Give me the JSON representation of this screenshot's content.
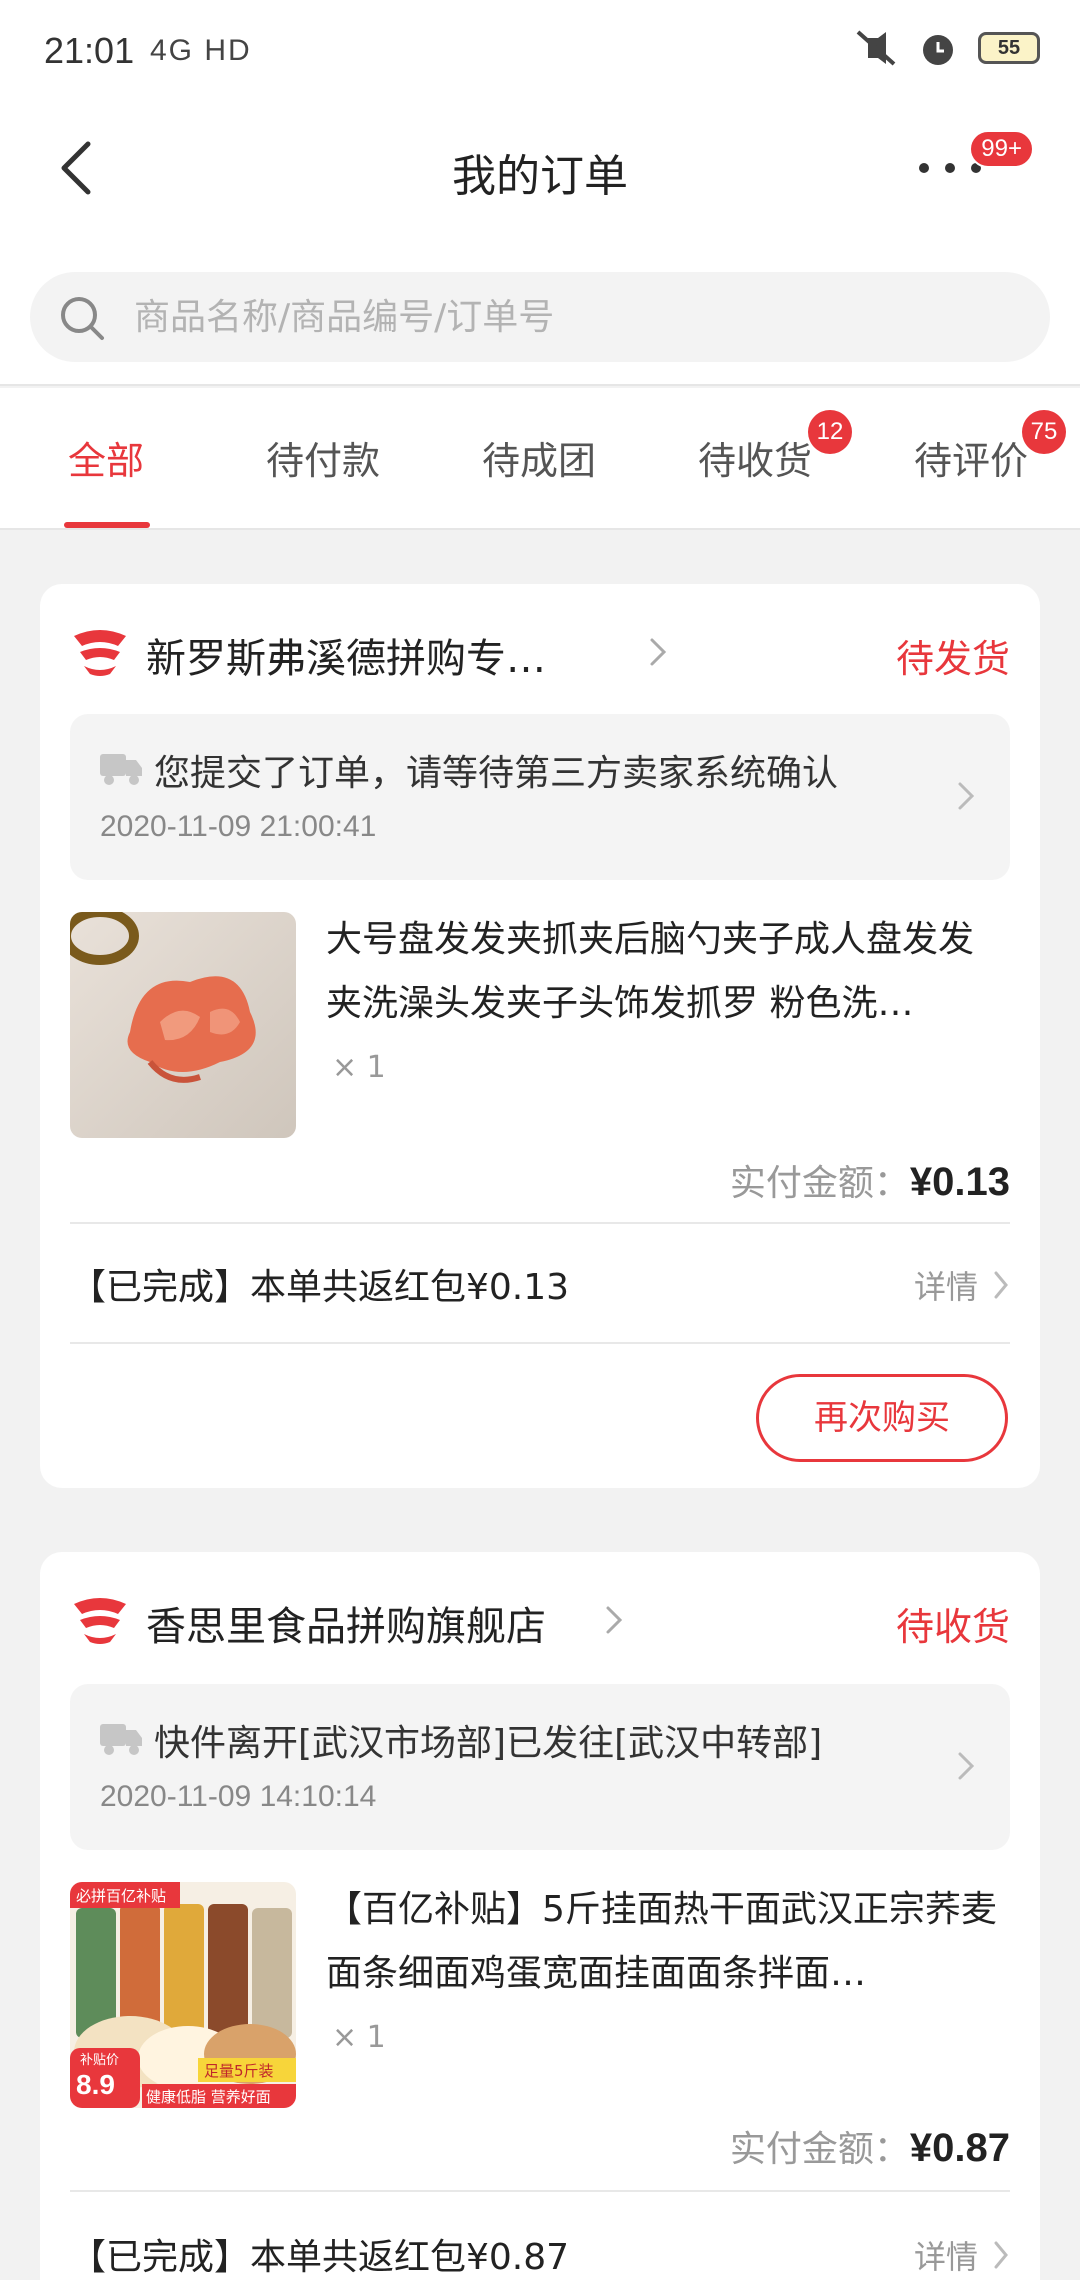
{
  "status_bar": {
    "time": "21:01",
    "network": "4G HD",
    "battery": "55"
  },
  "header": {
    "title": "我的订单",
    "more_badge": "99+"
  },
  "search": {
    "placeholder": "商品名称/商品编号/订单号"
  },
  "tabs": [
    {
      "label": "全部",
      "active": true
    },
    {
      "label": "待付款"
    },
    {
      "label": "待成团"
    },
    {
      "label": "待收货",
      "badge": "12"
    },
    {
      "label": "待评价",
      "badge": "75"
    }
  ],
  "orders": [
    {
      "shop_name": "新罗斯弗溪德拼购专…",
      "status": "待发货",
      "logistics_text": "您提交了订单，请等待第三方卖家系统确认",
      "logistics_time": "2020-11-09 21:00:41",
      "product_title": "大号盘发发夹抓夹后脑勺夹子成人盘发发夹洗澡头发夹子头饰发抓罗 粉色洗…",
      "quantity": "× 1",
      "paid_label": "实付金额：",
      "paid_amount": "¥0.13",
      "rebate_text": "【已完成】本单共返红包¥0.13",
      "detail_label": "详情",
      "rebuy_label": "再次购买"
    },
    {
      "shop_name": "香思里食品拼购旗舰店",
      "status": "待收货",
      "logistics_text": "快件离开[武汉市场部]已发往[武汉中转部]",
      "logistics_time": "2020-11-09 14:10:14",
      "product_title": "【百亿补贴】5斤挂面热干面武汉正宗荞麦面条细面鸡蛋宽面挂面面条拌面…",
      "quantity": "× 1",
      "paid_label": "实付金额：",
      "paid_amount": "¥0.87",
      "rebate_text": "【已完成】本单共返红包¥0.87",
      "detail_label": "详情",
      "product_img_tag": "必拼百亿补贴",
      "product_img_price": "8.9",
      "product_img_price_label": "补贴价",
      "product_img_banner": "足量5斤装",
      "product_img_slogan": "健康低脂 营养好面"
    }
  ],
  "colors": {
    "accent": "#e8373c"
  }
}
